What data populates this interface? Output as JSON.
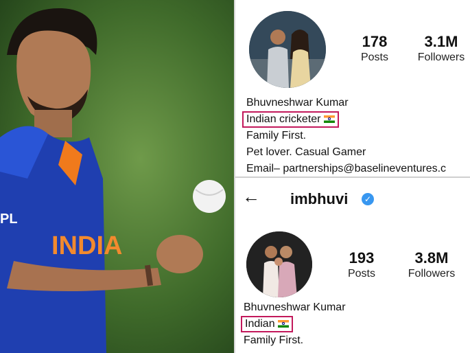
{
  "profile_old": {
    "stats": [
      {
        "value": "178",
        "label": "Posts"
      },
      {
        "value": "3.1M",
        "label": "Followers"
      }
    ],
    "bio": {
      "name": "Bhuvneshwar Kumar",
      "tagline": "Indian cricketer",
      "line2": "Family First.",
      "line3": "Pet lover. Casual Gamer",
      "line4": "Email– partnerships@baselineventures.c"
    }
  },
  "profile_new": {
    "username": "imbhuvi",
    "stats": [
      {
        "value": "193",
        "label": "Posts"
      },
      {
        "value": "3.8M",
        "label": "Followers"
      }
    ],
    "bio": {
      "name": "Bhuvneshwar Kumar",
      "tagline": "Indian",
      "line2": "Family First."
    }
  },
  "photo": {
    "jersey_text": "INDIA",
    "sponsor_text": "PL"
  },
  "colors": {
    "highlight_border": "#c2185b",
    "verified_blue": "#3897f0",
    "jersey_blue": "#1f3fb0"
  },
  "icons": {
    "back": "arrow-left-icon",
    "verified": "verified-badge-icon",
    "flag": "india-flag-icon"
  }
}
